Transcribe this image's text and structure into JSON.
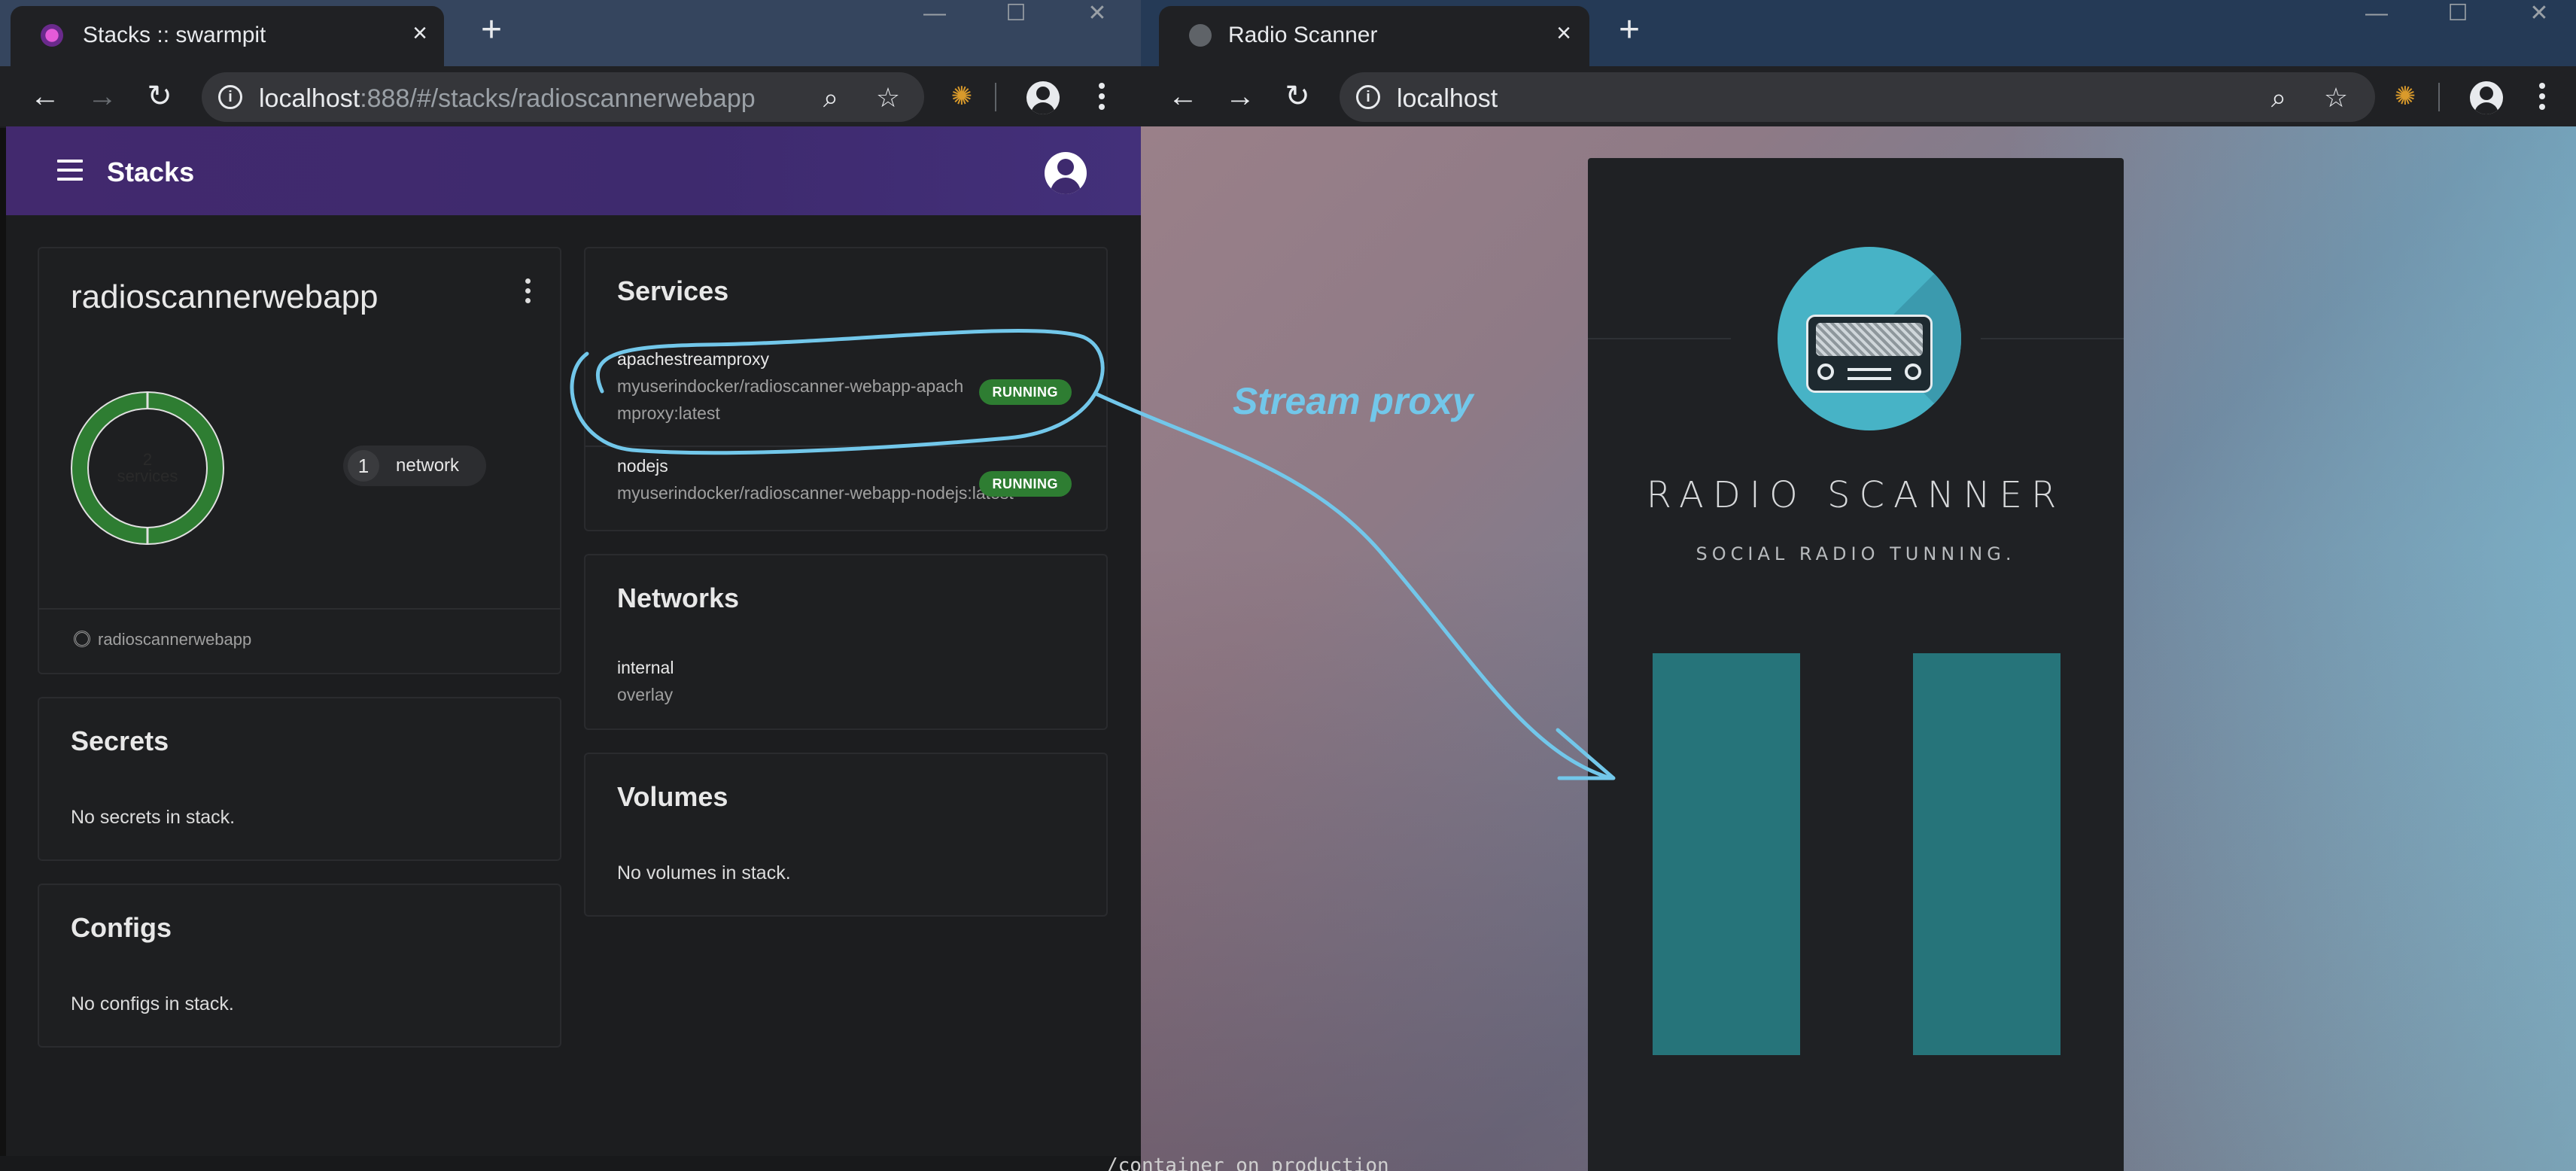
{
  "left_browser": {
    "tab": {
      "title": "Stacks :: swarmpit",
      "favicon": "swarmpit-icon"
    },
    "address": {
      "host": "localhost",
      "rest": ":888/#/stacks/radioscannerwebapp"
    },
    "app": {
      "page_title": "Stacks",
      "stack": {
        "name": "radioscannerwebapp",
        "services_count": "2",
        "services_label": "services",
        "network_count": "1",
        "network_label": "network",
        "footer_label": "radioscannerwebapp"
      },
      "services": {
        "title": "Services",
        "items": [
          {
            "name": "apachestreamproxy",
            "image_line1": "myuserindocker/radioscanner-webapp-apach",
            "image_line2": "mproxy:latest",
            "status": "RUNNING"
          },
          {
            "name": "nodejs",
            "image_line1": "myuserindocker/radioscanner-webapp-nodejs:latest",
            "status": "RUNNING"
          }
        ]
      },
      "networks": {
        "title": "Networks",
        "items": [
          {
            "name": "internal",
            "driver": "overlay"
          }
        ]
      },
      "volumes": {
        "title": "Volumes",
        "empty": "No volumes in stack."
      },
      "secrets": {
        "title": "Secrets",
        "empty": "No secrets in stack."
      },
      "configs": {
        "title": "Configs",
        "empty": "No configs in stack."
      }
    }
  },
  "right_browser": {
    "tab": {
      "title": "Radio Scanner",
      "favicon": "globe-icon"
    },
    "address": {
      "host": "localhost"
    },
    "page": {
      "title": "RADIO SCANNER",
      "subtitle": "SOCIAL RADIO TUNNING."
    }
  },
  "annotation": {
    "label": "Stream proxy"
  },
  "background_code": "/container on production",
  "colors": {
    "appbar": "#42296e",
    "running_badge": "#2e7d32",
    "donut": "#2e7d32",
    "annotation": "#72c7ea",
    "rs_logo": "#47b3c6",
    "rs_bars": "#26747a"
  }
}
